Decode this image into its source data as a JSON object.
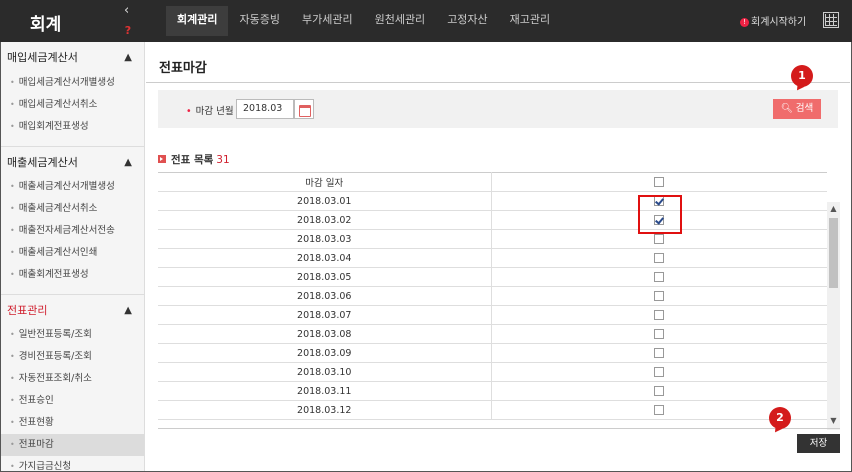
{
  "app": {
    "title": "회계",
    "collapse_icon": "chevron-left-icon",
    "help_icon": "help-headset-icon"
  },
  "top_menu": {
    "tabs": [
      {
        "label": "회계관리",
        "active": true
      },
      {
        "label": "자동증빙",
        "active": false
      },
      {
        "label": "부가세관리",
        "active": false
      },
      {
        "label": "원천세관리",
        "active": false
      },
      {
        "label": "고정자산",
        "active": false
      },
      {
        "label": "재고관리",
        "active": false
      }
    ],
    "start_label": "회계시작하기",
    "start_icon": "alert-circle-icon",
    "calculator_icon": "calculator-icon"
  },
  "sidebar": {
    "sections": [
      {
        "title": "매입세금계산서",
        "color": "#222222",
        "items": [
          "매입세금계산서개별생성",
          "매입세금계산서취소",
          "매입회계전표생성"
        ]
      },
      {
        "title": "매출세금계산서",
        "color": "#222222",
        "items": [
          "매출세금계산서개별생성",
          "매출세금계산서취소",
          "매출전자세금계산서전송",
          "매출세금계산서인쇄",
          "매출회계전표생성"
        ]
      },
      {
        "title": "전표관리",
        "color": "#d0202f",
        "items": [
          "일반전표등록/조회",
          "경비전표등록/조회",
          "자동전표조회/취소",
          "전표승인",
          "전표현황",
          "전표마감",
          "가지급금신청"
        ],
        "selected": "전표마감"
      }
    ]
  },
  "page": {
    "title": "전표마감",
    "filter": {
      "label": "마감 년월",
      "required_mark": "•",
      "value": "2018.03",
      "calendar_icon": "calendar-icon",
      "search_label": "검색",
      "search_icon": "search-icon"
    },
    "list": {
      "title": "전표 목록",
      "count": "31",
      "columns": [
        "마감 일자",
        ""
      ],
      "rows": [
        {
          "date": "2018.03.01",
          "checked": true
        },
        {
          "date": "2018.03.02",
          "checked": true
        },
        {
          "date": "2018.03.03",
          "checked": false
        },
        {
          "date": "2018.03.04",
          "checked": false
        },
        {
          "date": "2018.03.05",
          "checked": false
        },
        {
          "date": "2018.03.06",
          "checked": false
        },
        {
          "date": "2018.03.07",
          "checked": false
        },
        {
          "date": "2018.03.08",
          "checked": false
        },
        {
          "date": "2018.03.09",
          "checked": false
        },
        {
          "date": "2018.03.10",
          "checked": false
        },
        {
          "date": "2018.03.11",
          "checked": false
        },
        {
          "date": "2018.03.12",
          "checked": false
        }
      ]
    },
    "save_label": "저장",
    "callouts": [
      "1",
      "2"
    ],
    "accent_color": "#d41b1b"
  }
}
